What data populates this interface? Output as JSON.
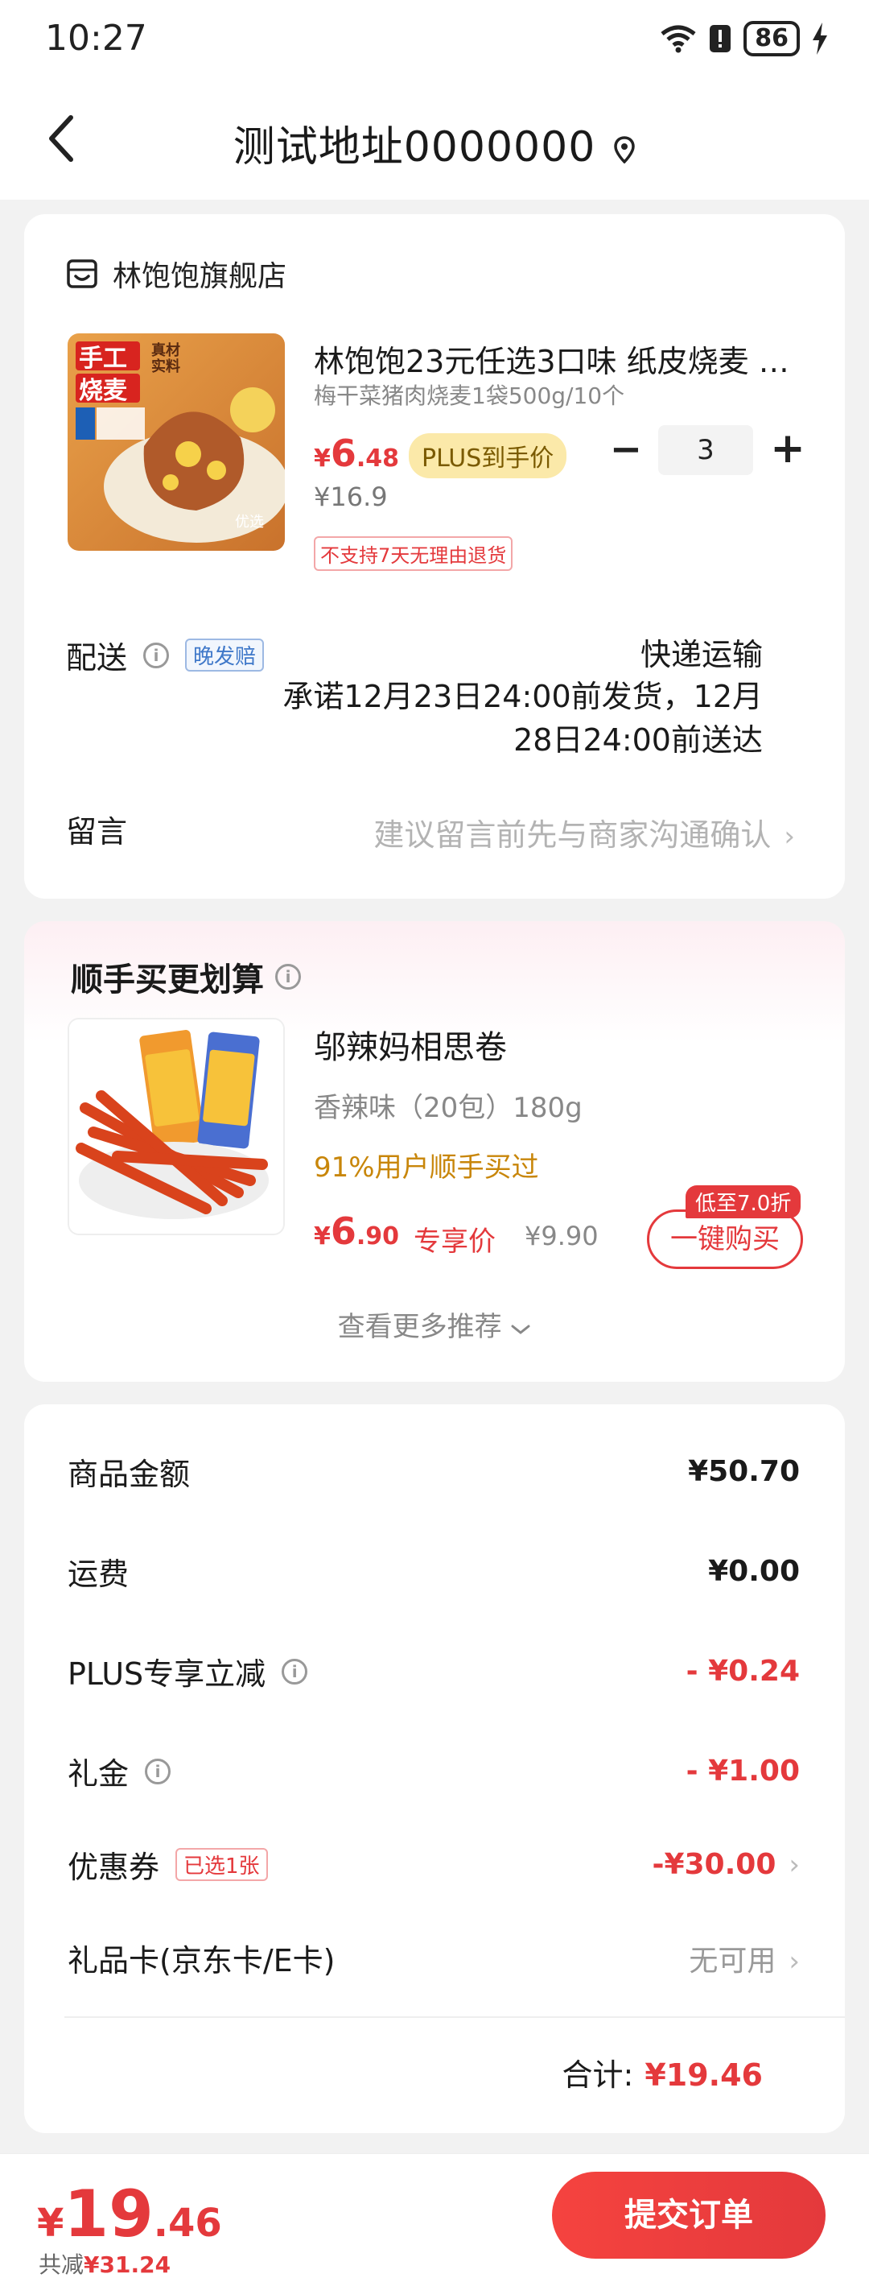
{
  "status_bar": {
    "time": "10:27",
    "battery": "86"
  },
  "header": {
    "address_title": "测试地址0000000"
  },
  "order": {
    "shop_name": "林饱饱旗舰店",
    "product": {
      "title": "林饱饱23元任选3口味 纸皮烧麦 梅干菜猪肉烧麦1袋500g/10个",
      "spec": "梅干菜猪肉烧麦1袋500g/10个",
      "price_currency": "¥",
      "price_int": "6",
      "price_dec": ".48",
      "plus_badge": "PLUS到手价",
      "original_price": "¥16.9",
      "return_policy": "不支持7天无理由退货",
      "quantity": "3",
      "image_text_main": "手工烧麦",
      "image_text_side": "真材实料",
      "image_text_brand": "优选"
    },
    "delivery": {
      "label": "配送",
      "late_tag": "晚发赔",
      "method": "快递运输",
      "promise": "承诺12月23日24:00前发货，12月28日24:00前送达"
    },
    "message": {
      "label": "留言",
      "placeholder": "建议留言前先与商家沟通确认"
    }
  },
  "recommend": {
    "title": "顺手买更划算",
    "product": {
      "name": "邬辣妈相思卷",
      "spec": "香辣味（20包）180g",
      "stat": "91%用户顺手买过",
      "price_currency": "¥",
      "price_int": "6",
      "price_dec": ".90",
      "price_label": "专享价",
      "original_price": "¥9.90",
      "discount_tag": "低至7.0折",
      "buy_button": "一键购买"
    },
    "more_link": "查看更多推荐"
  },
  "summary": {
    "rows": [
      {
        "label": "商品金额",
        "value": "¥50.70"
      },
      {
        "label": "运费",
        "value": "¥0.00"
      },
      {
        "label": "PLUS专享立减",
        "value": "- ¥0.24"
      },
      {
        "label": "礼金",
        "value": "- ¥1.00"
      },
      {
        "label": "优惠券",
        "tag": "已选1张",
        "value": "-¥30.00"
      },
      {
        "label": "礼品卡(京东卡/E卡)",
        "value": "无可用"
      }
    ],
    "total_label": "合计:",
    "total_value": "¥19.46"
  },
  "bottom_bar": {
    "currency": "¥",
    "price_int": "19",
    "price_dec": ".46",
    "saved_label": "共减",
    "saved_value": "¥31.24",
    "submit_label": "提交订单"
  },
  "colors": {
    "accent": "#e4393c",
    "plus_gold": "#fbe9a9",
    "recommend_gold": "#c8860a"
  }
}
